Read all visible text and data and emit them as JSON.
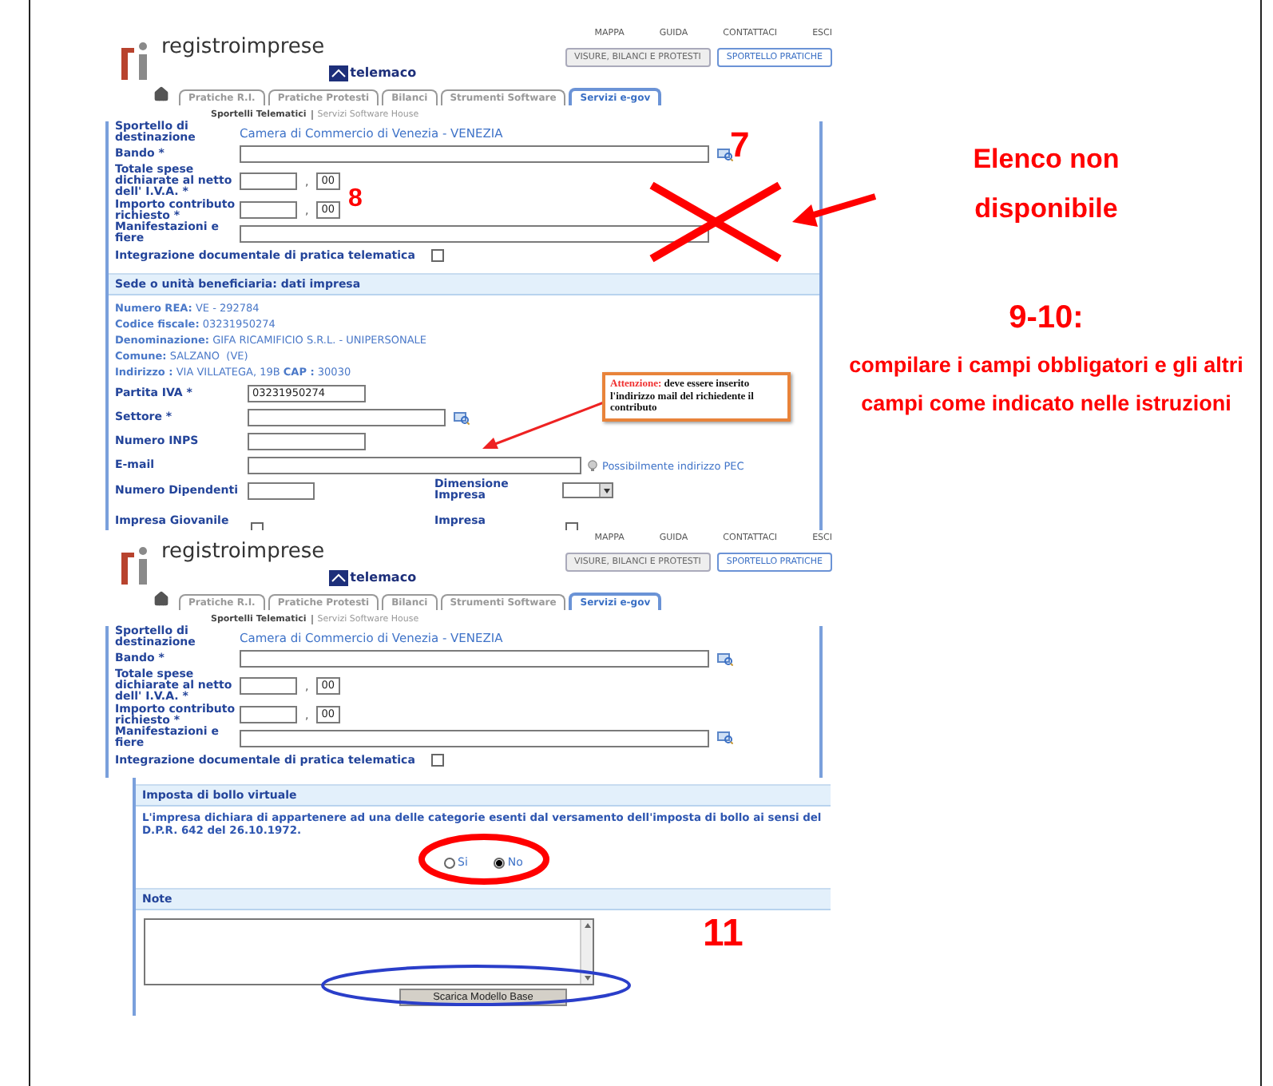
{
  "screens": [
    {
      "header": {
        "logo": "registroimprese",
        "partner": "telemaco",
        "links": [
          "MAPPA",
          "GUIDA",
          "CONTATTACI",
          "ESCI"
        ],
        "sections": [
          {
            "label": "VISURE, BILANCI E PROTESTI",
            "selected": false
          },
          {
            "label": "SPORTELLO PRATICHE",
            "selected": true
          }
        ],
        "tabs": [
          {
            "label": "Pratiche R.I.",
            "selected": false
          },
          {
            "label": "Pratiche Protesti",
            "selected": false
          },
          {
            "label": "Bilanci",
            "selected": false
          },
          {
            "label": "Strumenti Software",
            "selected": false
          },
          {
            "label": "Servizi e-gov",
            "selected": true
          }
        ]
      },
      "breadcrumb": [
        "Sportelli Telematici",
        "Servizi Software House"
      ],
      "fields": [
        {
          "kind": "value",
          "label": "Sportello di destinazione",
          "value": "Camera di Commercio di Venezia - VENEZIA"
        },
        {
          "kind": "lookup",
          "label": "Bando *"
        },
        {
          "kind": "amount",
          "label": "Totale spese dichiarate al netto dell' I.V.A. *",
          "separator": ",",
          "decimals": "00"
        },
        {
          "kind": "amount",
          "label": "Importo contributo richiesto *",
          "separator": ",",
          "decimals": "00"
        },
        {
          "kind": "text",
          "label": "Manifestazioni e fiere"
        },
        {
          "kind": "checkbox",
          "label": "Integrazione documentale di pratica telematica",
          "checked": false
        }
      ],
      "company": {
        "title": "Sede o unità beneficiaria: dati impresa",
        "info": [
          "**Numero REA:** VE - 292784",
          "**Codice fiscale:** 03231950274",
          "**Denominazione:** GIFA RICAMIFICIO S.R.L. - UNIPERSONALE",
          "**Comune:** SALZANO  (VE)",
          "**Indirizzo :** VIA VILLATEGA, 19B **CAP :** 30030"
        ],
        "fields": [
          {
            "kind": "text",
            "label": "Partita IVA *",
            "value": "03231950274"
          },
          {
            "kind": "lookup",
            "label": "Settore *"
          },
          {
            "kind": "text",
            "label": "Numero INPS"
          },
          {
            "kind": "hint",
            "label": "E-mail",
            "hint": "Possibilmente indirizzo PEC"
          }
        ],
        "grid": [
          {
            "kind": "text",
            "label": "Numero Dipendenti"
          },
          {
            "kind": "select",
            "label": "Dimensione Impresa"
          },
          {
            "kind": "checkbox",
            "label": "Impresa Giovanile",
            "checked": false
          },
          {
            "kind": "checkbox",
            "label": "Impresa",
            "checked": false
          }
        ]
      }
    },
    {
      "header": {
        "logo": "registroimprese",
        "partner": "telemaco",
        "links": [
          "MAPPA",
          "GUIDA",
          "CONTATTACI",
          "ESCI"
        ],
        "sections": [
          {
            "label": "VISURE, BILANCI E PROTESTI",
            "selected": false
          },
          {
            "label": "SPORTELLO PRATICHE",
            "selected": true
          }
        ],
        "tabs": [
          {
            "label": "Pratiche R.I.",
            "selected": false
          },
          {
            "label": "Pratiche Protesti",
            "selected": false
          },
          {
            "label": "Bilanci",
            "selected": false
          },
          {
            "label": "Strumenti Software",
            "selected": false
          },
          {
            "label": "Servizi e-gov",
            "selected": true
          }
        ]
      },
      "breadcrumb": [
        "Sportelli Telematici",
        "Servizi Software House"
      ],
      "fields": [
        {
          "kind": "value",
          "label": "Sportello di destinazione",
          "value": "Camera di Commercio di Venezia - VENEZIA"
        },
        {
          "kind": "lookup",
          "label": "Bando *"
        },
        {
          "kind": "amount",
          "label": "Totale spese dichiarate al netto dell' I.V.A. *",
          "separator": ",",
          "decimals": "00"
        },
        {
          "kind": "amount",
          "label": "Importo contributo richiesto *",
          "separator": ",",
          "decimals": "00"
        },
        {
          "kind": "lookup",
          "label": "Manifestazioni e fiere"
        },
        {
          "kind": "checkbox",
          "label": "Integrazione documentale di pratica telematica",
          "checked": false
        }
      ]
    }
  ],
  "stamp_duty": {
    "title": "Imposta di bollo virtuale",
    "statement": "L'impresa dichiara di appartenere ad una delle categorie esenti dal versamento dell'imposta di bollo ai sensi del D.P.R. 642 del 26.10.1972.",
    "options": [
      {
        "label": "Si",
        "selected": false
      },
      {
        "label": "No",
        "selected": true
      }
    ],
    "notes_title": "Note",
    "button": "Scarica Modello Base"
  },
  "annotations": {
    "step_7": "7",
    "step_8": "8",
    "step_11": "11",
    "callout": {
      "title": "Attenzione:",
      "text": "deve essere inserito l'indirizzo mail del richiedente il contributo"
    },
    "unavailable": "Elenco non disponibile",
    "instructions": {
      "title": "9-10:",
      "text": "compilare i campi obbligatori e gli altri campi come indicato nelle istruzioni"
    }
  }
}
